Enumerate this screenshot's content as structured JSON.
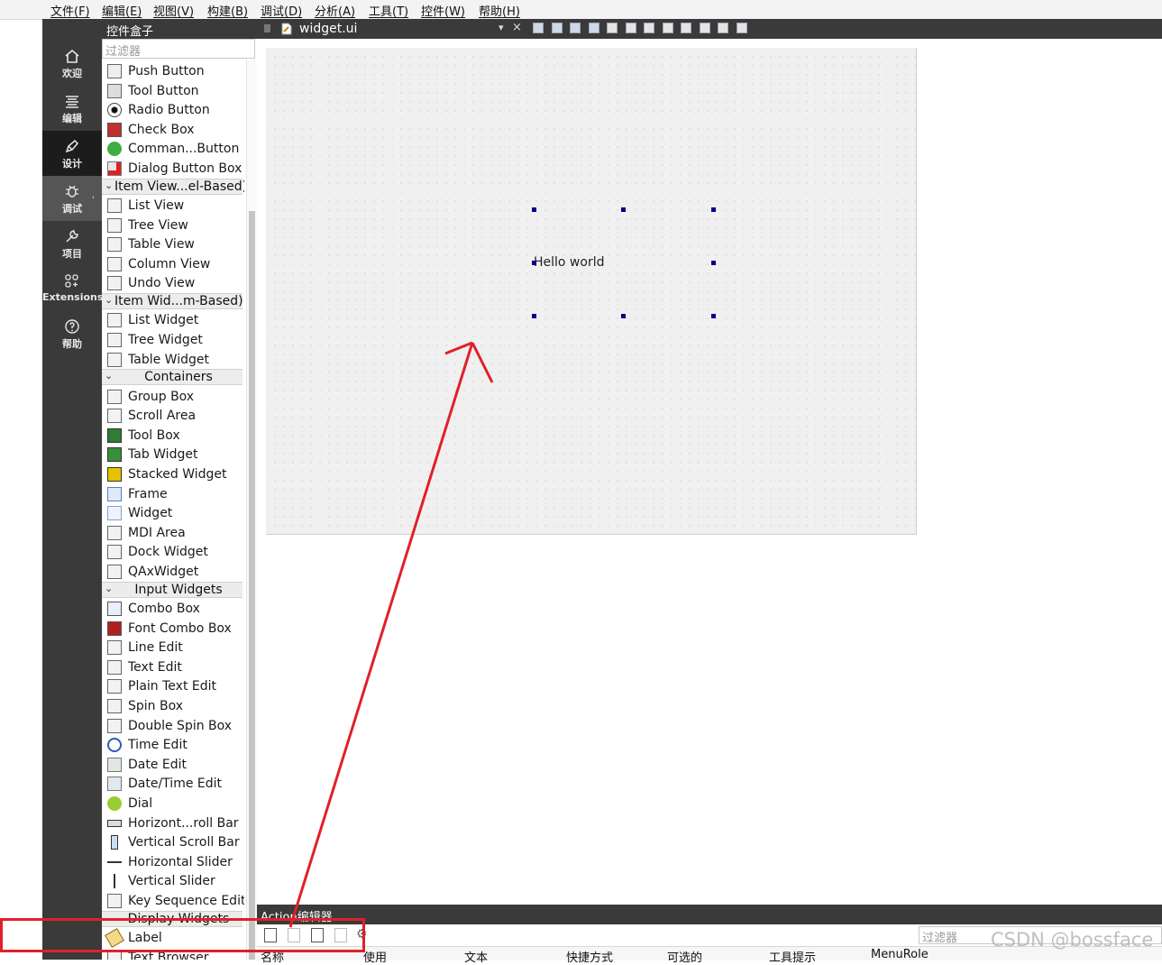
{
  "menubar": {
    "items": [
      "文件(F)",
      "编辑(E)",
      "视图(V)",
      "构建(B)",
      "调试(D)",
      "分析(A)",
      "工具(T)",
      "控件(W)",
      "帮助(H)"
    ]
  },
  "modebar": {
    "modes": [
      {
        "label": "欢迎",
        "icon": "home-icon"
      },
      {
        "label": "编辑",
        "icon": "edit-lines-icon"
      },
      {
        "label": "设计",
        "icon": "pen-icon"
      },
      {
        "label": "调试",
        "icon": "bug-icon"
      },
      {
        "label": "项目",
        "icon": "wrench-icon"
      },
      {
        "label": "Extensions",
        "icon": "extensions-icon"
      },
      {
        "label": "帮助",
        "icon": "help-icon"
      }
    ],
    "active": "设计",
    "hovered": "调试",
    "debug_marker": ","
  },
  "widget_box": {
    "title": "控件盒子",
    "filter_placeholder": "过滤器",
    "entries": [
      {
        "kind": "item",
        "label": "Push Button",
        "icon": "push-button-icon"
      },
      {
        "kind": "item",
        "label": "Tool Button",
        "icon": "tool-button-icon"
      },
      {
        "kind": "item",
        "label": "Radio Button",
        "icon": "radio-button-icon"
      },
      {
        "kind": "item",
        "label": "Check Box",
        "icon": "check-box-icon"
      },
      {
        "kind": "item",
        "label": "Comman...Button",
        "icon": "command-link-icon"
      },
      {
        "kind": "item",
        "label": "Dialog Button Box",
        "icon": "dialog-button-box-icon"
      },
      {
        "kind": "category",
        "label": "Item View...el-Based)"
      },
      {
        "kind": "item",
        "label": "List View",
        "icon": "list-view-icon"
      },
      {
        "kind": "item",
        "label": "Tree View",
        "icon": "tree-view-icon"
      },
      {
        "kind": "item",
        "label": "Table View",
        "icon": "table-view-icon"
      },
      {
        "kind": "item",
        "label": "Column View",
        "icon": "column-view-icon"
      },
      {
        "kind": "item",
        "label": "Undo View",
        "icon": "undo-view-icon"
      },
      {
        "kind": "category",
        "label": "Item Wid...m-Based)"
      },
      {
        "kind": "item",
        "label": "List Widget",
        "icon": "list-widget-icon"
      },
      {
        "kind": "item",
        "label": "Tree Widget",
        "icon": "tree-widget-icon"
      },
      {
        "kind": "item",
        "label": "Table Widget",
        "icon": "table-widget-icon"
      },
      {
        "kind": "category",
        "label": "Containers"
      },
      {
        "kind": "item",
        "label": "Group Box",
        "icon": "group-box-icon"
      },
      {
        "kind": "item",
        "label": "Scroll Area",
        "icon": "scroll-area-icon"
      },
      {
        "kind": "item",
        "label": "Tool Box",
        "icon": "tool-box-icon"
      },
      {
        "kind": "item",
        "label": "Tab Widget",
        "icon": "tab-widget-icon"
      },
      {
        "kind": "item",
        "label": "Stacked Widget",
        "icon": "stacked-widget-icon"
      },
      {
        "kind": "item",
        "label": "Frame",
        "icon": "frame-icon"
      },
      {
        "kind": "item",
        "label": "Widget",
        "icon": "widget-icon"
      },
      {
        "kind": "item",
        "label": "MDI Area",
        "icon": "mdi-area-icon"
      },
      {
        "kind": "item",
        "label": "Dock Widget",
        "icon": "dock-widget-icon"
      },
      {
        "kind": "item",
        "label": "QAxWidget",
        "icon": "qaxwidget-icon"
      },
      {
        "kind": "category",
        "label": "Input Widgets"
      },
      {
        "kind": "item",
        "label": "Combo Box",
        "icon": "combo-box-icon"
      },
      {
        "kind": "item",
        "label": "Font Combo Box",
        "icon": "font-combo-box-icon"
      },
      {
        "kind": "item",
        "label": "Line Edit",
        "icon": "line-edit-icon"
      },
      {
        "kind": "item",
        "label": "Text Edit",
        "icon": "text-edit-icon"
      },
      {
        "kind": "item",
        "label": "Plain Text Edit",
        "icon": "plain-text-edit-icon"
      },
      {
        "kind": "item",
        "label": "Spin Box",
        "icon": "spin-box-icon"
      },
      {
        "kind": "item",
        "label": "Double Spin Box",
        "icon": "double-spin-box-icon"
      },
      {
        "kind": "item",
        "label": "Time Edit",
        "icon": "time-edit-icon"
      },
      {
        "kind": "item",
        "label": "Date Edit",
        "icon": "date-edit-icon"
      },
      {
        "kind": "item",
        "label": "Date/Time Edit",
        "icon": "date-time-edit-icon"
      },
      {
        "kind": "item",
        "label": "Dial",
        "icon": "dial-icon"
      },
      {
        "kind": "item",
        "label": "Horizont...roll Bar",
        "icon": "horizontal-scroll-bar-icon"
      },
      {
        "kind": "item",
        "label": "Vertical Scroll Bar",
        "icon": "vertical-scroll-bar-icon"
      },
      {
        "kind": "item",
        "label": "Horizontal Slider",
        "icon": "horizontal-slider-icon"
      },
      {
        "kind": "item",
        "label": "Vertical Slider",
        "icon": "vertical-slider-icon"
      },
      {
        "kind": "item",
        "label": "Key Sequence Edit",
        "icon": "key-sequence-edit-icon"
      },
      {
        "kind": "category",
        "label": "Display Widgets"
      },
      {
        "kind": "item",
        "label": "Label",
        "icon": "label-icon"
      },
      {
        "kind": "item",
        "label": "Text Browser",
        "icon": "text-browser-icon"
      }
    ]
  },
  "editor": {
    "file_name": "widget.ui",
    "form_label_text": "Hello world"
  },
  "action_editor": {
    "title": "Action编辑器",
    "filter_placeholder": "过滤器",
    "columns": [
      "名称",
      "使用",
      "文本",
      "快捷方式",
      "可选的",
      "工具提示",
      "MenuRole"
    ]
  },
  "watermark": "CSDN @bossface",
  "colors": {
    "annotation_red": "#e0202a",
    "dark_panel": "#3a3a3a",
    "handle_blue": "#00008b"
  }
}
